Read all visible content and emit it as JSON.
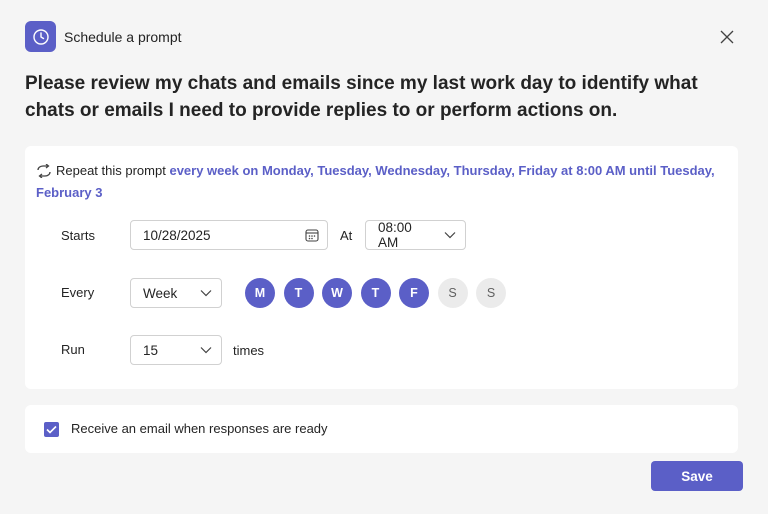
{
  "header": {
    "title": "Schedule a prompt",
    "icon": "clock-icon",
    "close_icon": "close-icon"
  },
  "prompt": {
    "text": "Please review my chats and emails since my last work day to identify what chats or emails I need to provide replies to or perform actions on."
  },
  "schedule": {
    "repeat_prefix": "Repeat this prompt",
    "repeat_summary": "every week on Monday, Tuesday, Wednesday, Thursday, Friday at 8:00 AM until Tuesday, February 3",
    "starts_label": "Starts",
    "start_date": "10/28/2025",
    "at_label": "At",
    "time": "08:00 AM",
    "every_label": "Every",
    "frequency": "Week",
    "days": [
      {
        "label": "M",
        "selected": true
      },
      {
        "label": "T",
        "selected": true
      },
      {
        "label": "W",
        "selected": true
      },
      {
        "label": "T",
        "selected": true
      },
      {
        "label": "F",
        "selected": true
      },
      {
        "label": "S",
        "selected": false
      },
      {
        "label": "S",
        "selected": false
      }
    ],
    "run_label": "Run",
    "run_count": "15",
    "times_label": "times"
  },
  "email": {
    "label": "Receive an email when responses are ready",
    "checked": true
  },
  "actions": {
    "save_label": "Save"
  },
  "colors": {
    "accent": "#5b5fc7",
    "background": "#f5f5f5",
    "card": "#ffffff"
  }
}
